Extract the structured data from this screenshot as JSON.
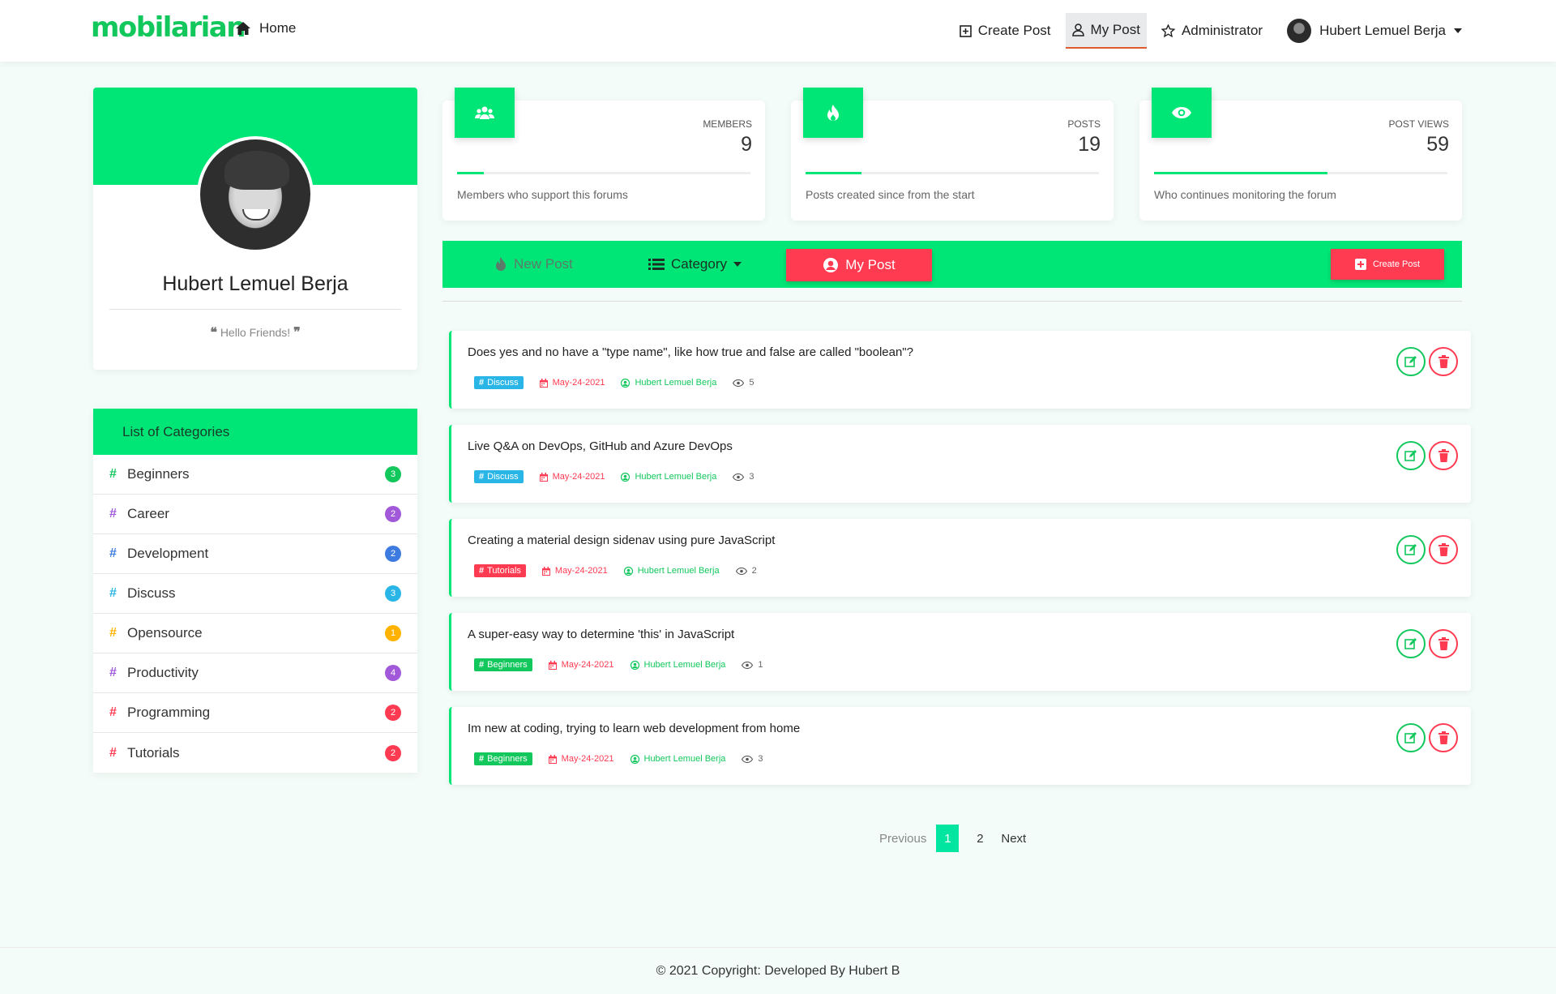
{
  "nav": {
    "brand": "mobilarian",
    "home": "Home",
    "create_post": "Create Post",
    "my_post": "My Post",
    "administrator": "Administrator",
    "user_name": "Hubert Lemuel Berja"
  },
  "profile": {
    "name": "Hubert Lemuel Berja",
    "quote": "Hello Friends!"
  },
  "categories": {
    "title": "List of Categories",
    "items": [
      {
        "label": "Beginners",
        "count": "3",
        "color": "#12c75c"
      },
      {
        "label": "Career",
        "count": "2",
        "color": "#a259d9"
      },
      {
        "label": "Development",
        "count": "2",
        "color": "#3d7be0"
      },
      {
        "label": "Discuss",
        "count": "3",
        "color": "#29b6e6"
      },
      {
        "label": "Opensource",
        "count": "1",
        "color": "#ffb300"
      },
      {
        "label": "Productivity",
        "count": "4",
        "color": "#a259d9"
      },
      {
        "label": "Programming",
        "count": "2",
        "color": "#ff3b52"
      },
      {
        "label": "Tutorials",
        "count": "2",
        "color": "#ff3b52"
      }
    ]
  },
  "stats": [
    {
      "label": "MEMBERS",
      "value": "9",
      "desc": "Members who support this forums",
      "fill": 0.09,
      "icon": "users-icon"
    },
    {
      "label": "POSTS",
      "value": "19",
      "desc": "Posts created since from the start",
      "fill": 0.19,
      "icon": "fire-icon"
    },
    {
      "label": "POST VIEWS",
      "value": "59",
      "desc": "Who continues monitoring the forum",
      "fill": 0.59,
      "icon": "eye-icon"
    }
  ],
  "toolbar": {
    "new_post": "New Post",
    "category": "Category",
    "my_post": "My Post",
    "create_post": "Create Post"
  },
  "posts": [
    {
      "title": "Does yes and no have a \"type name\", like how true and false are called \"boolean\"?",
      "tag": "Discuss",
      "tag_color": "#29b6e6",
      "date": "May-24-2021",
      "author": "Hubert Lemuel Berja",
      "views": "5"
    },
    {
      "title": "Live Q&A on DevOps, GitHub and Azure DevOps",
      "tag": "Discuss",
      "tag_color": "#29b6e6",
      "date": "May-24-2021",
      "author": "Hubert Lemuel Berja",
      "views": "3"
    },
    {
      "title": "Creating a material design sidenav using pure JavaScript",
      "tag": "Tutorials",
      "tag_color": "#ff3b52",
      "date": "May-24-2021",
      "author": "Hubert Lemuel Berja",
      "views": "2"
    },
    {
      "title": "A super-easy way to determine 'this' in JavaScript",
      "tag": "Beginners",
      "tag_color": "#12c75c",
      "date": "May-24-2021",
      "author": "Hubert Lemuel Berja",
      "views": "1"
    },
    {
      "title": "Im new at coding, trying to learn web development from home",
      "tag": "Beginners",
      "tag_color": "#12c75c",
      "date": "May-24-2021",
      "author": "Hubert Lemuel Berja",
      "views": "3"
    }
  ],
  "pagination": {
    "previous": "Previous",
    "pages": [
      "1",
      "2"
    ],
    "active": "1",
    "next": "Next"
  },
  "footer": {
    "text": "© 2021 Copyright: Developed By Hubert B"
  }
}
